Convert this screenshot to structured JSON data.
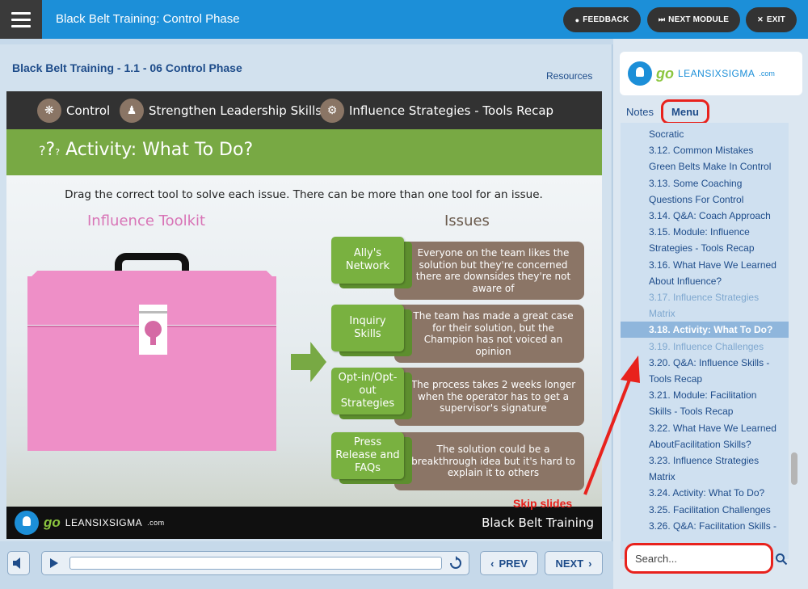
{
  "app": {
    "title": "Black Belt Training: Control Phase",
    "feedback_label": "FEEDBACK",
    "next_module_label": "NEXT MODULE",
    "exit_label": "EXIT"
  },
  "main": {
    "course_title": "Black Belt Training - 1.1 - 06 Control Phase",
    "resources_label": "Resources"
  },
  "slide": {
    "breadcrumbs": [
      {
        "label": "Control",
        "icon": "ship-wheel-icon"
      },
      {
        "label": "Strengthen Leadership Skills",
        "icon": "people-icon"
      },
      {
        "label": "Influence Strategies - Tools Recap",
        "icon": "influence-icon"
      }
    ],
    "activity_title": "Activity: What To Do?",
    "activity_icon": "?",
    "instruction": "Drag the correct tool to solve each issue. There can be more than one tool for an issue.",
    "toolkit_heading": "Influence Toolkit",
    "issues_heading": "Issues",
    "rows": [
      {
        "tool": "Ally's Network",
        "issue": "Everyone on the team likes the solution but they're concerned there are downsides they're not aware of"
      },
      {
        "tool": "Inquiry Skills",
        "issue": "The team has made a great case for their solution, but the Champion has not voiced an opinion"
      },
      {
        "tool": "Opt-in/Opt-out Strategies",
        "issue": "The process takes 2 weeks longer when the operator has to get a supervisor's signature"
      },
      {
        "tool": "Press Release and FAQs",
        "issue": "The solution could be a breakthrough idea but it's hard to explain it to others"
      }
    ],
    "footer_logo_go": "go",
    "footer_logo_rest": "LEANSIXSIGMA",
    "footer_logo_com": ".com",
    "footer_right": "Black Belt Training"
  },
  "player": {
    "prev_label": "PREV",
    "next_label": "NEXT",
    "progress": 0
  },
  "sidebar": {
    "logo_go": "go",
    "logo_rest": "LEANSIXSIGMA",
    "logo_com": ".com",
    "notes_tab": "Notes",
    "menu_tab": "Menu",
    "menu_items": [
      {
        "label": "Socratic",
        "state": "normal"
      },
      {
        "label": "3.12. Common Mistakes",
        "state": "normal"
      },
      {
        "label": "Green Belts Make In Control",
        "state": "normal"
      },
      {
        "label": "3.13. Some Coaching",
        "state": "normal"
      },
      {
        "label": "Questions For Control",
        "state": "normal"
      },
      {
        "label": "3.14. Q&A: Coach Approach",
        "state": "normal"
      },
      {
        "label": "3.15. Module: Influence",
        "state": "normal"
      },
      {
        "label": "Strategies - Tools Recap",
        "state": "normal"
      },
      {
        "label": "3.16. What Have We Learned",
        "state": "normal"
      },
      {
        "label": "About Influence?",
        "state": "normal"
      },
      {
        "label": "3.17. Influence Strategies",
        "state": "visited"
      },
      {
        "label": "Matrix",
        "state": "visited"
      },
      {
        "label": "3.18. Activity: What To Do?",
        "state": "active"
      },
      {
        "label": "3.19. Influence Challenges",
        "state": "visited"
      },
      {
        "label": "3.20. Q&A: Influence Skills -",
        "state": "normal"
      },
      {
        "label": "Tools Recap",
        "state": "normal"
      },
      {
        "label": "3.21. Module: Facilitation",
        "state": "normal"
      },
      {
        "label": "Skills - Tools Recap",
        "state": "normal"
      },
      {
        "label": "3.22. What Have We Learned",
        "state": "normal"
      },
      {
        "label": "AboutFacilitation Skills?",
        "state": "normal"
      },
      {
        "label": "3.23. Influence Strategies",
        "state": "normal"
      },
      {
        "label": "Matrix",
        "state": "normal"
      },
      {
        "label": "3.24. Activity: What To Do?",
        "state": "normal"
      },
      {
        "label": "3.25. Facilitation Challenges",
        "state": "normal"
      },
      {
        "label": "3.26. Q&A: Facilitation Skills -",
        "state": "normal"
      }
    ],
    "search_placeholder": "Search..."
  },
  "annotation": {
    "label": "Skip slides",
    "color": "#e8221d"
  },
  "colors": {
    "topbar": "#1c8fd8",
    "activity_band": "#78a944",
    "tool_chip": "#79b140",
    "issue_box": "#8b7566",
    "toolbox": "#ee8fc7",
    "toolkit_heading": "#d874b6"
  }
}
